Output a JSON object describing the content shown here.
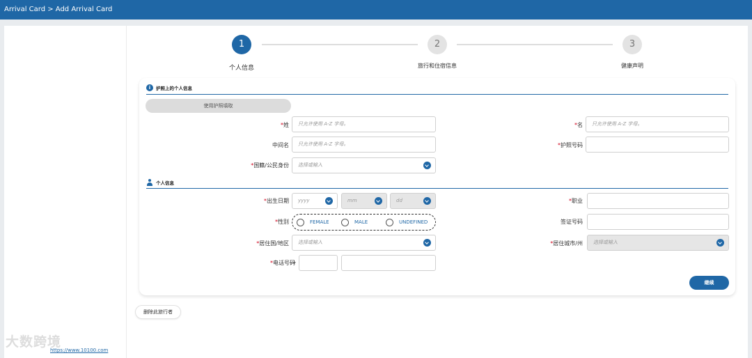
{
  "breadcrumb": "Arrival Card > Add Arrival Card",
  "steps": [
    {
      "num": "1",
      "label": "个人信息"
    },
    {
      "num": "2",
      "label": "旅行和住宿信息"
    },
    {
      "num": "3",
      "label": "健康声明"
    }
  ],
  "passport_section": {
    "title": "护照上的个人信息",
    "scan_button": "使用护照填取",
    "fields": {
      "surname": {
        "label": "姓",
        "placeholder": "只允许使用 A-Z 字母。"
      },
      "given_name": {
        "label": "名",
        "placeholder": "只允许使用 A-Z 字母。"
      },
      "middle_name": {
        "label": "中间名",
        "placeholder": "只允许使用 A-Z 字母。"
      },
      "passport_no": {
        "label": "护照号码",
        "placeholder": ""
      },
      "nationality": {
        "label": "国籍/公民身份",
        "placeholder": "选择或输入"
      }
    }
  },
  "personal_section": {
    "title": "个人信息",
    "fields": {
      "dob": {
        "label": "出生日期",
        "year": "yyyy",
        "month": "mm",
        "day": "dd"
      },
      "occupation": {
        "label": "职业"
      },
      "gender": {
        "label": "性别",
        "options": [
          "FEMALE",
          "MALE",
          "UNDEFINED"
        ]
      },
      "visa_no": {
        "label": "签证号码"
      },
      "residence_country": {
        "label": "居住国/地区",
        "placeholder": "选择或输入"
      },
      "residence_city": {
        "label": "居住城市/州",
        "placeholder": "选择或输入"
      },
      "phone": {
        "label": "电话号码",
        "plus": "+"
      }
    }
  },
  "actions": {
    "continue": "继续",
    "delete": "删除此旅行者"
  },
  "watermark": {
    "text": "大数跨境",
    "sub": "https://www.10100.com"
  },
  "colors": {
    "brand": "#1f67a6",
    "required": "#d0021b"
  }
}
